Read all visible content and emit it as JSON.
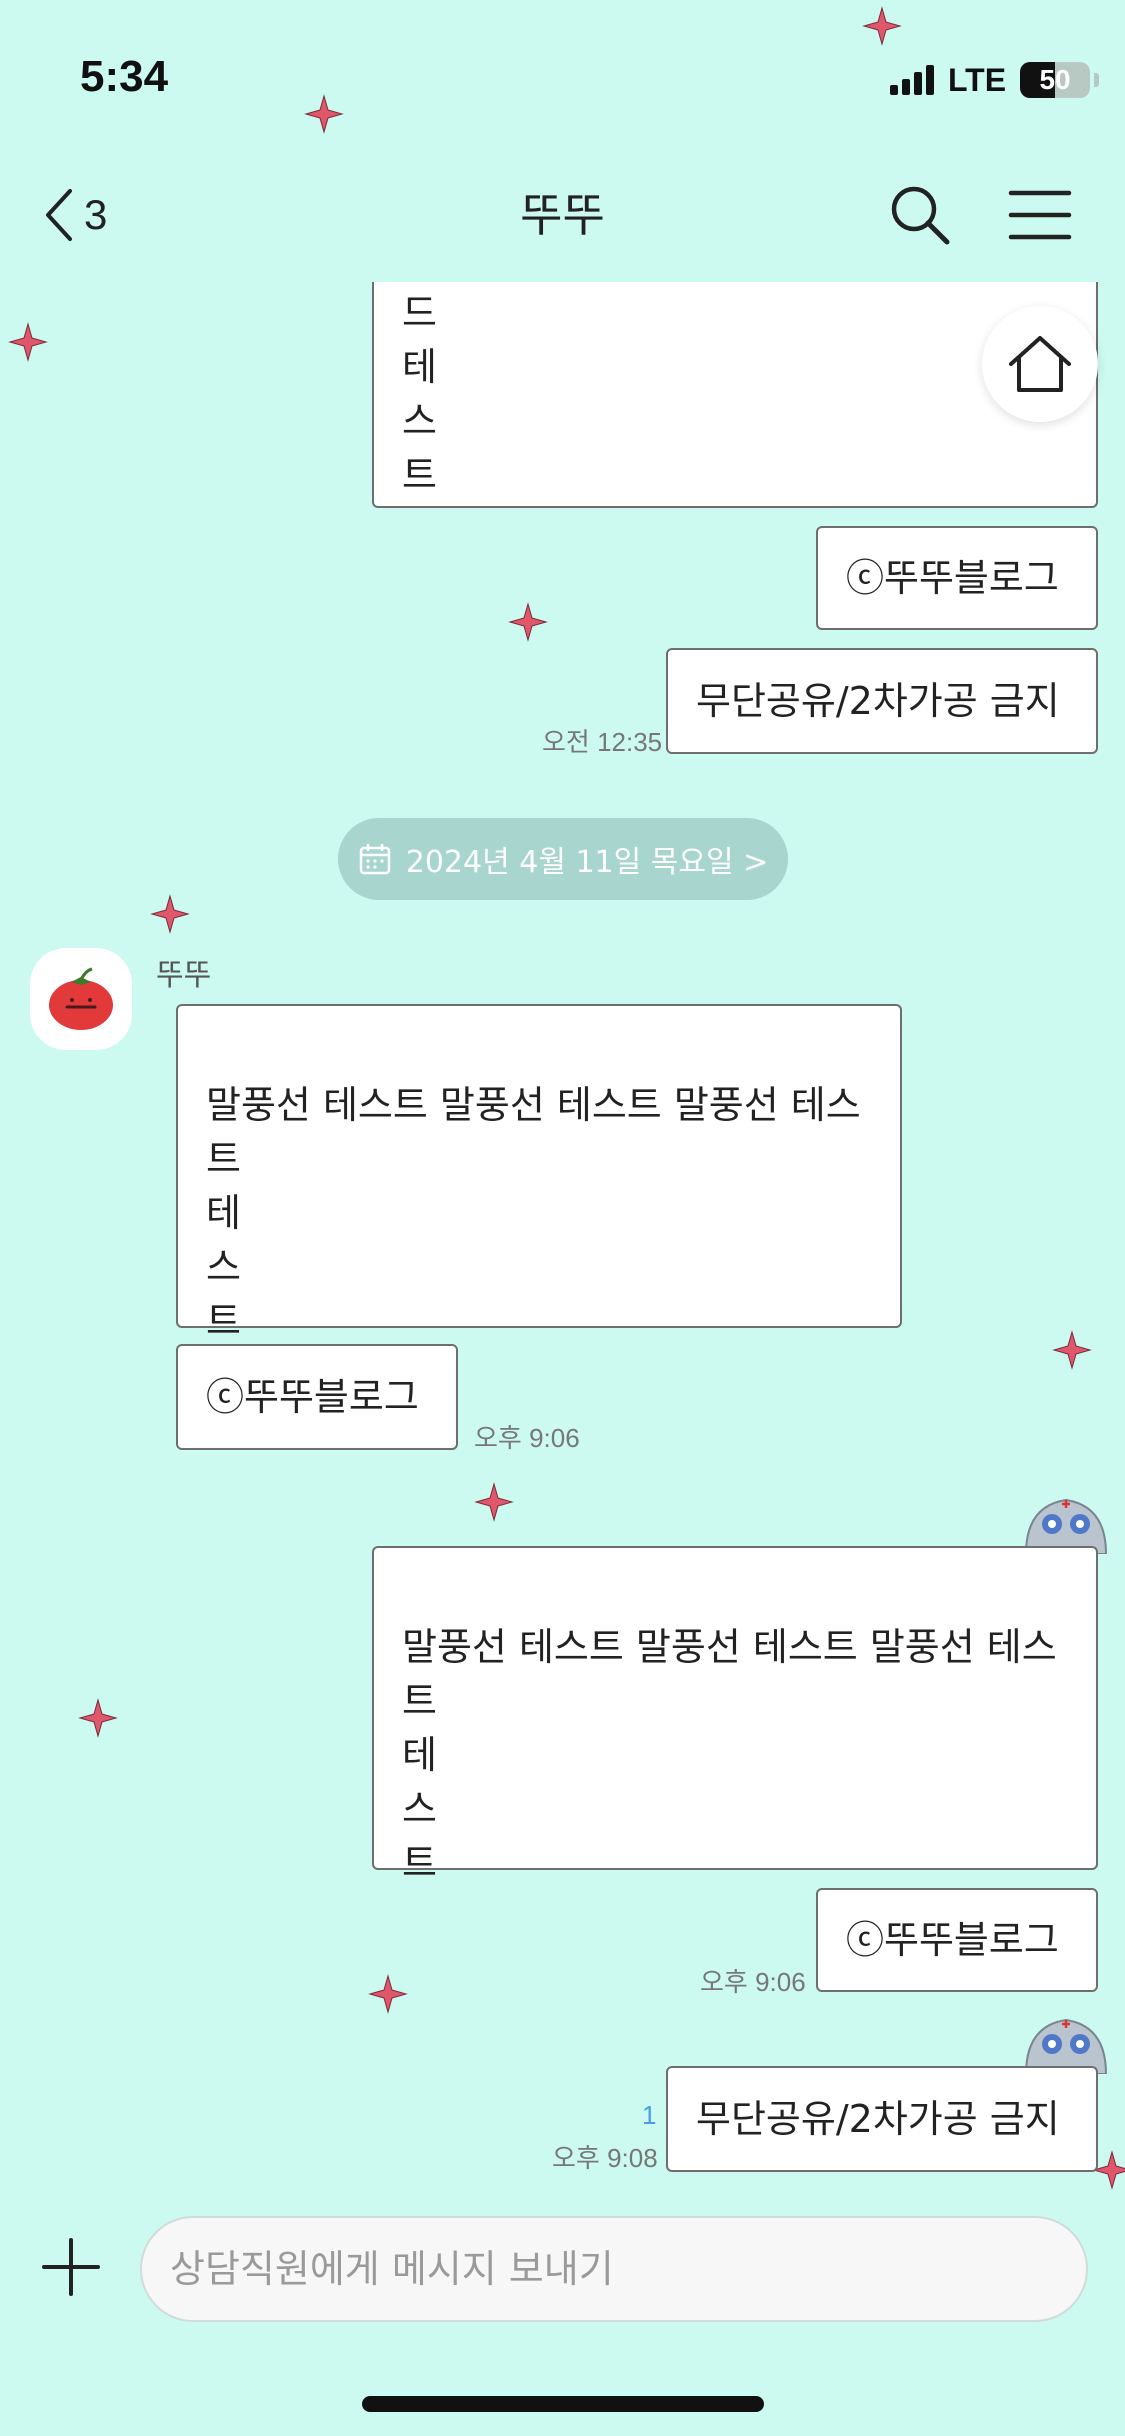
{
  "status": {
    "time": "5:34",
    "network": "LTE",
    "battery": "50"
  },
  "header": {
    "back_count": "3",
    "title": "뚜뚜"
  },
  "messages_top": {
    "partial_text": "드\n테\n스\n트",
    "copyright": "ⓒ뚜뚜블로그",
    "notice": "무단공유/2차가공 금지",
    "notice_time": "오전 12:35"
  },
  "date_divider": {
    "label": "2024년 4월 11일 목요일 >"
  },
  "incoming": {
    "sender": "뚜뚜",
    "text": "말풍선 테스트 말풍선 테스트 말풍선 테스\n트\n테\n스\n트",
    "copyright": "ⓒ뚜뚜블로그",
    "time": "오후 9:06"
  },
  "outgoing": {
    "text": "말풍선 테스트 말풍선 테스트 말풍선 테스\n트\n테\n스\n트",
    "copyright": "ⓒ뚜뚜블로그",
    "copyright_time": "오후 9:06",
    "notice": "무단공유/2차가공 금지",
    "notice_unread": "1",
    "notice_time": "오후 9:08"
  },
  "input": {
    "placeholder": "상담직원에게 메시지 보내기"
  },
  "colors": {
    "background": "#ccfaf1",
    "star": "#e0566a",
    "date_pill": "#a8d6cf",
    "unread": "#4a9ee8"
  },
  "icons": [
    "back-icon",
    "search-icon",
    "menu-icon",
    "home-icon",
    "calendar-icon",
    "plus-icon",
    "star-icon"
  ]
}
